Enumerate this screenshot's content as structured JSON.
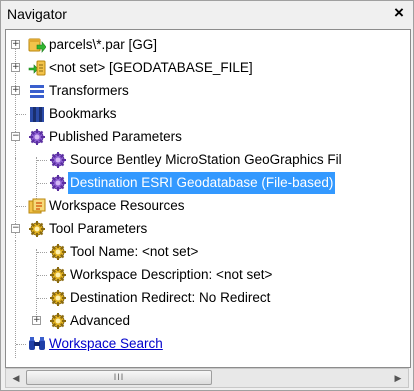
{
  "panel": {
    "title": "Navigator",
    "close_glyph": "×"
  },
  "tree": {
    "items": [
      {
        "label": "parcels\\*.par [GG]",
        "icon": "source-dataset-icon",
        "expander": "+"
      },
      {
        "label": "<not set> [GEODATABASE_FILE]",
        "icon": "destination-dataset-icon",
        "expander": "+"
      },
      {
        "label": "Transformers",
        "icon": "transformers-icon",
        "expander": "+"
      },
      {
        "label": "Bookmarks",
        "icon": "bookmarks-icon",
        "expander": ""
      },
      {
        "label": "Published Parameters",
        "icon": "published-parameters-icon",
        "expander": "−"
      },
      {
        "label": "Source Bentley MicroStation GeoGraphics Fil",
        "icon": "parameter-icon",
        "expander": ""
      },
      {
        "label": "Destination ESRI Geodatabase (File-based)",
        "icon": "parameter-icon",
        "expander": "",
        "selected": true
      },
      {
        "label": "Workspace Resources",
        "icon": "workspace-resources-icon",
        "expander": ""
      },
      {
        "label": "Tool Parameters",
        "icon": "tool-parameters-icon",
        "expander": "−"
      },
      {
        "label": "Tool Name: <not set>",
        "icon": "tool-parameter-icon",
        "expander": ""
      },
      {
        "label": "Workspace Description: <not set>",
        "icon": "tool-parameter-icon",
        "expander": ""
      },
      {
        "label": "Destination Redirect: No Redirect",
        "icon": "tool-parameter-icon",
        "expander": ""
      },
      {
        "label": "Advanced",
        "icon": "tool-parameter-icon",
        "expander": "+"
      },
      {
        "label": "Workspace Search",
        "icon": "binoculars-icon",
        "expander": "",
        "link": true
      }
    ]
  },
  "scrollbar": {
    "left_arrow": "◀",
    "right_arrow": "▶",
    "grip": "III"
  },
  "colors": {
    "selection": "#3399ff",
    "link": "#0000cc"
  }
}
